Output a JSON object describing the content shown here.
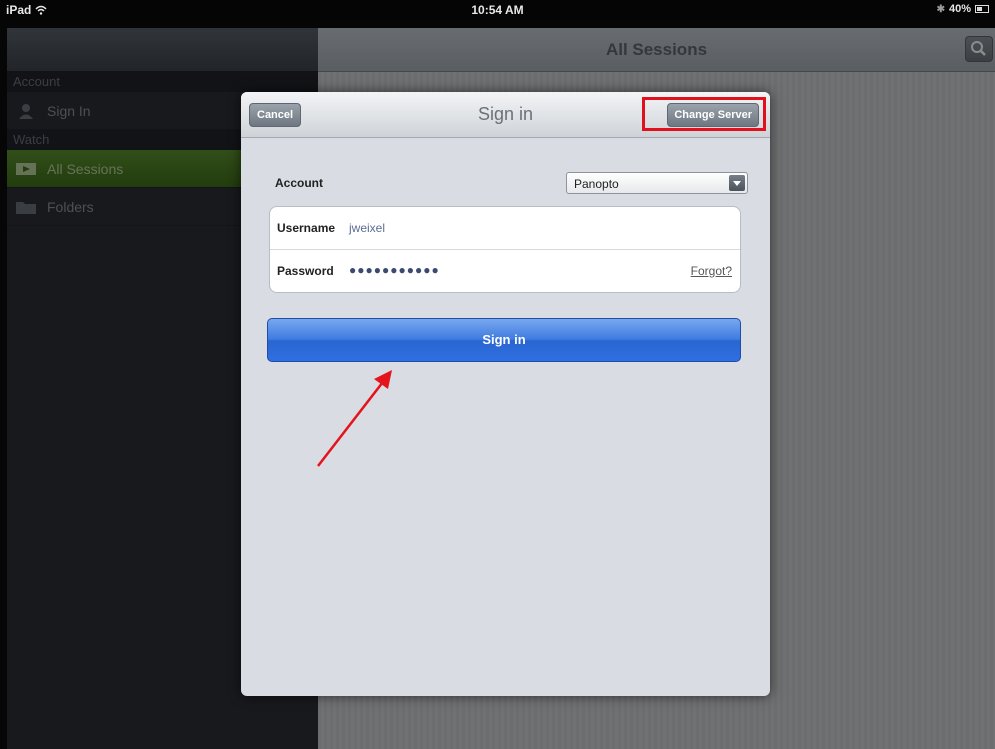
{
  "status_bar": {
    "device": "iPad",
    "time": "10:54 AM",
    "battery": "40%"
  },
  "sidebar": {
    "sections": [
      {
        "label": "Account"
      },
      {
        "label": "Watch"
      }
    ],
    "items": [
      {
        "label": "Sign In",
        "icon": "person-icon"
      },
      {
        "label": "All Sessions",
        "icon": "video-icon",
        "active": true
      },
      {
        "label": "Folders",
        "icon": "folder-icon"
      }
    ]
  },
  "main": {
    "title": "All Sessions",
    "search_icon": "search-icon"
  },
  "modal": {
    "title": "Sign in",
    "cancel_label": "Cancel",
    "change_server_label": "Change Server",
    "account_label": "Account",
    "account_value": "Panopto",
    "username_label": "Username",
    "username_value": "jweixel",
    "password_label": "Password",
    "password_value": "●●●●●●●●●●●",
    "forgot_label": "Forgot?",
    "signin_label": "Sign in",
    "highlight_color": "#e0101c",
    "primary_color": "#2e6fe0"
  }
}
